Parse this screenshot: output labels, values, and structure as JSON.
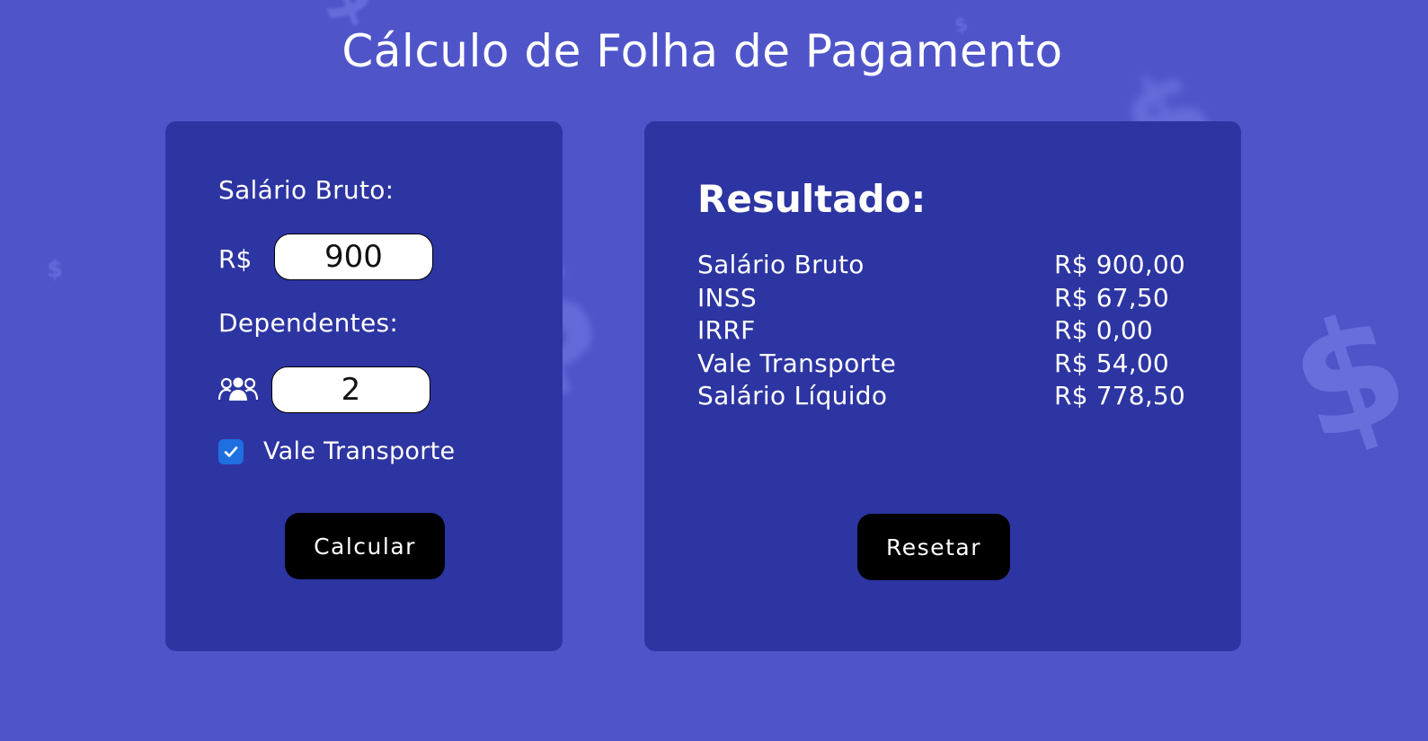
{
  "page": {
    "title": "Cálculo de Folha de Pagamento"
  },
  "form": {
    "salary_label": "Salário Bruto:",
    "currency_prefix": "R$",
    "salary_value": "900",
    "dependents_label": "Dependentes:",
    "dependents_icon": "people-icon",
    "dependents_value": "2",
    "transport_checked": true,
    "transport_label": "Vale Transporte",
    "calculate_label": "Calcular"
  },
  "result": {
    "title": "Resultado:",
    "rows": [
      {
        "label": "Salário Bruto",
        "value": "R$ 900,00"
      },
      {
        "label": "INSS",
        "value": "R$ 67,50"
      },
      {
        "label": "IRRF",
        "value": "R$ 0,00"
      },
      {
        "label": "Vale Transporte",
        "value": "R$ 54,00"
      },
      {
        "label": "Salário Líquido",
        "value": "R$ 778,50"
      }
    ],
    "reset_label": "Resetar"
  },
  "colors": {
    "background": "#4f55c9",
    "panel": "#2d35a2",
    "button": "#000000",
    "checkbox": "#1f6fe0",
    "text": "#ffffff"
  },
  "background_icons": [
    "dollar-sign-icon"
  ]
}
